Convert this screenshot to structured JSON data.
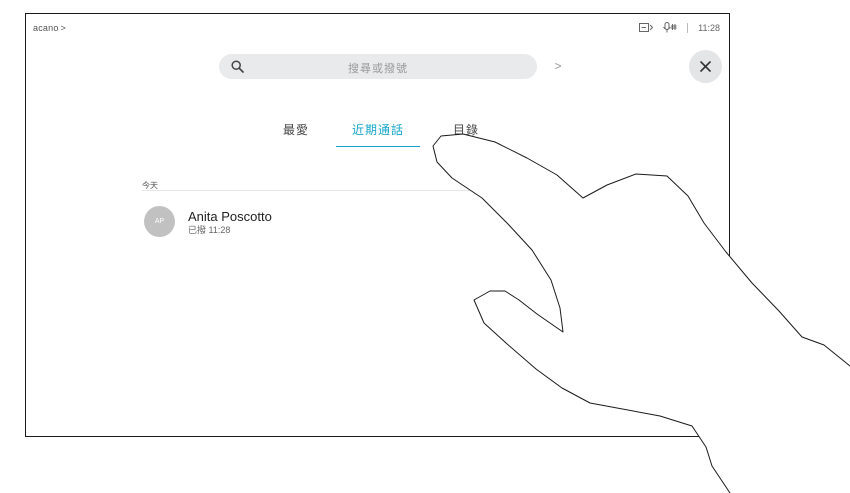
{
  "header": {
    "brand": "acano",
    "brand_chevron": ">",
    "time": "11:28",
    "icons": [
      "screen-share-icon",
      "microphone-icon"
    ]
  },
  "search": {
    "placeholder": "搜尋或撥號",
    "go_chevron": ">"
  },
  "tabs": [
    {
      "label": "最愛",
      "active": false
    },
    {
      "label": "近期通話",
      "active": true
    },
    {
      "label": "目錄",
      "active": false
    }
  ],
  "recents": {
    "section_label": "今天",
    "items": [
      {
        "initials": "AP",
        "name": "Anita Poscotto",
        "detail": "已撥 11:28"
      }
    ]
  },
  "colors": {
    "accent": "#14a5c9",
    "avatar": "#c1c1c1",
    "search_bg": "#e9eaec"
  }
}
